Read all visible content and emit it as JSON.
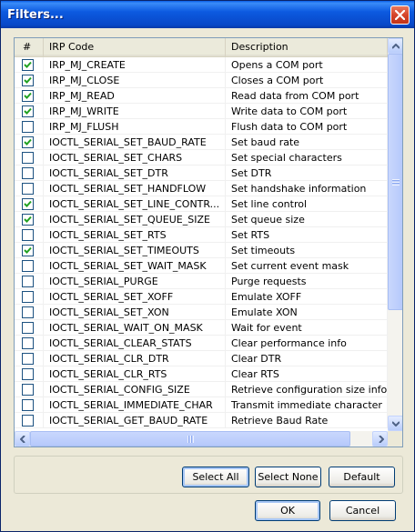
{
  "window": {
    "title": "Filters..."
  },
  "columns": [
    "#",
    "IRP Code",
    "Description"
  ],
  "rows": [
    {
      "checked": true,
      "code": "IRP_MJ_CREATE",
      "desc": "Opens a COM port"
    },
    {
      "checked": true,
      "code": "IRP_MJ_CLOSE",
      "desc": "Closes a COM port"
    },
    {
      "checked": true,
      "code": "IRP_MJ_READ",
      "desc": "Read data from COM port"
    },
    {
      "checked": true,
      "code": "IRP_MJ_WRITE",
      "desc": "Write data to COM port"
    },
    {
      "checked": false,
      "code": "IRP_MJ_FLUSH",
      "desc": "Flush data to COM port"
    },
    {
      "checked": true,
      "code": "IOCTL_SERIAL_SET_BAUD_RATE",
      "desc": "Set baud rate"
    },
    {
      "checked": false,
      "code": "IOCTL_SERIAL_SET_CHARS",
      "desc": "Set special characters"
    },
    {
      "checked": false,
      "code": "IOCTL_SERIAL_SET_DTR",
      "desc": "Set DTR"
    },
    {
      "checked": false,
      "code": "IOCTL_SERIAL_SET_HANDFLOW",
      "desc": "Set handshake information"
    },
    {
      "checked": true,
      "code": "IOCTL_SERIAL_SET_LINE_CONTR...",
      "desc": "Set line control"
    },
    {
      "checked": true,
      "code": "IOCTL_SERIAL_SET_QUEUE_SIZE",
      "desc": "Set queue size"
    },
    {
      "checked": false,
      "code": "IOCTL_SERIAL_SET_RTS",
      "desc": "Set RTS"
    },
    {
      "checked": true,
      "code": "IOCTL_SERIAL_SET_TIMEOUTS",
      "desc": "Set timeouts"
    },
    {
      "checked": false,
      "code": "IOCTL_SERIAL_SET_WAIT_MASK",
      "desc": "Set current event mask"
    },
    {
      "checked": false,
      "code": "IOCTL_SERIAL_PURGE",
      "desc": "Purge requests"
    },
    {
      "checked": false,
      "code": "IOCTL_SERIAL_SET_XOFF",
      "desc": "Emulate XOFF"
    },
    {
      "checked": false,
      "code": "IOCTL_SERIAL_SET_XON",
      "desc": "Emulate XON"
    },
    {
      "checked": false,
      "code": "IOCTL_SERIAL_WAIT_ON_MASK",
      "desc": "Wait for event"
    },
    {
      "checked": false,
      "code": "IOCTL_SERIAL_CLEAR_STATS",
      "desc": "Clear performance info"
    },
    {
      "checked": false,
      "code": "IOCTL_SERIAL_CLR_DTR",
      "desc": "Clear DTR"
    },
    {
      "checked": false,
      "code": "IOCTL_SERIAL_CLR_RTS",
      "desc": "Clear RTS"
    },
    {
      "checked": false,
      "code": "IOCTL_SERIAL_CONFIG_SIZE",
      "desc": "Retrieve configuration size informatio"
    },
    {
      "checked": false,
      "code": "IOCTL_SERIAL_IMMEDIATE_CHAR",
      "desc": "Transmit immediate character"
    },
    {
      "checked": false,
      "code": "IOCTL_SERIAL_GET_BAUD_RATE",
      "desc": "Retrieve Baud Rate"
    }
  ],
  "buttons": {
    "select_all": "Select All",
    "select_none": "Select None",
    "default": "Default",
    "ok": "OK",
    "cancel": "Cancel"
  },
  "icons": {
    "close": "close-icon",
    "check": "check-icon",
    "scroll_up": "arrow-up-icon",
    "scroll_down": "arrow-down-icon",
    "scroll_left": "arrow-left-icon",
    "scroll_right": "arrow-right-icon"
  },
  "colors": {
    "titlebar": "#0a5fe8",
    "check": "#21a121",
    "border": "#7f9db9"
  }
}
